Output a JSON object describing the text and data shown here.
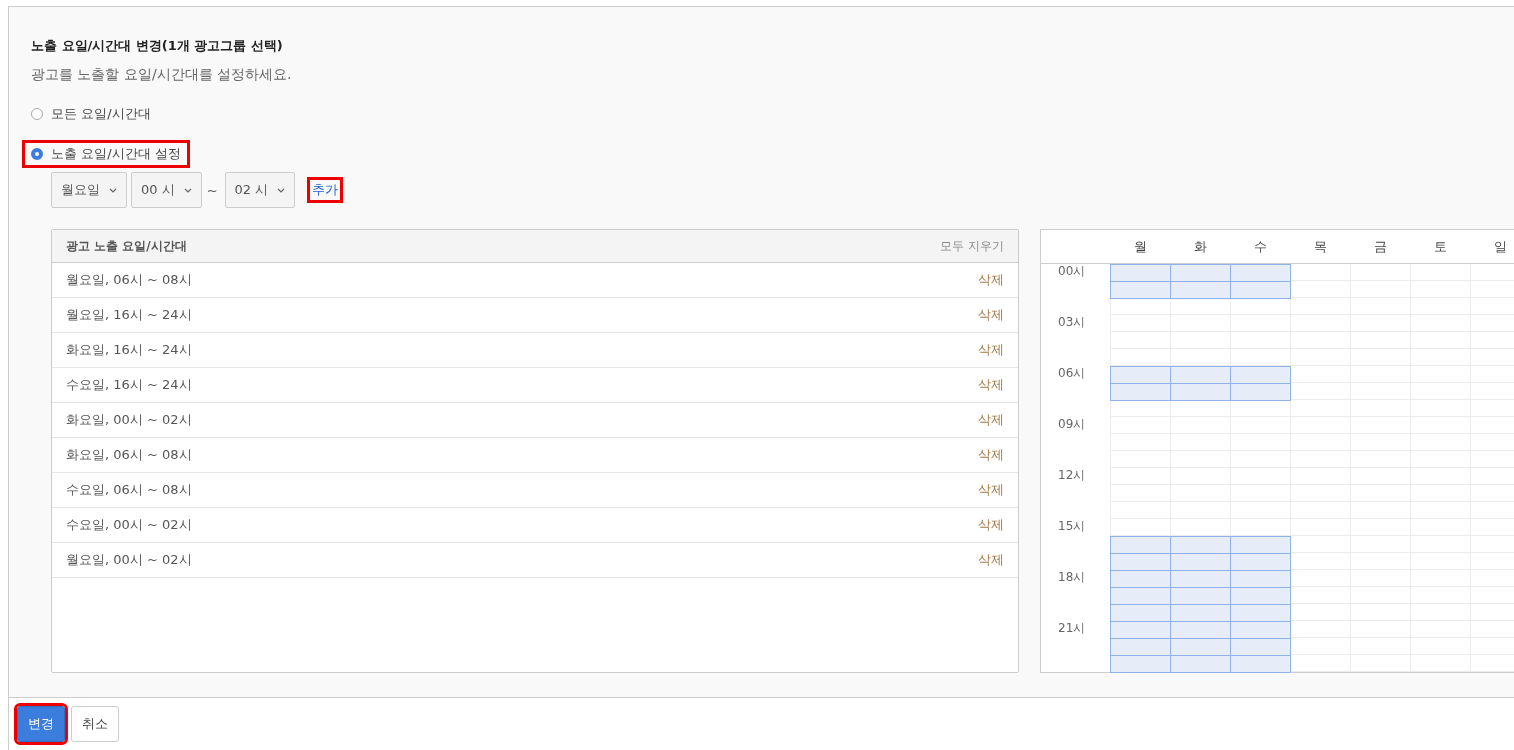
{
  "title": "노출 요일/시간대 변경(1개 광고그룹 선택)",
  "description": "광고를 노출할 요일/시간대를 설정하세요.",
  "radios": [
    {
      "label": "모든 요일/시간대",
      "selected": false,
      "highlighted": false
    },
    {
      "label": "노출 요일/시간대 설정",
      "selected": true,
      "highlighted": true
    }
  ],
  "picker": {
    "day": "월요일",
    "start": "00 시",
    "separator": "~",
    "end": "02 시",
    "add_link": {
      "label": "추가",
      "highlighted": true
    }
  },
  "schedule_list": {
    "header": "광고 노출 요일/시간대",
    "clear_all": "모두 지우기",
    "rows": [
      {
        "text": "월요일, 06시 ~ 08시",
        "action": "삭제"
      },
      {
        "text": "월요일, 16시 ~ 24시",
        "action": "삭제"
      },
      {
        "text": "화요일, 16시 ~ 24시",
        "action": "삭제"
      },
      {
        "text": "수요일, 16시 ~ 24시",
        "action": "삭제"
      },
      {
        "text": "화요일, 00시 ~ 02시",
        "action": "삭제"
      },
      {
        "text": "화요일, 06시 ~ 08시",
        "action": "삭제"
      },
      {
        "text": "수요일, 06시 ~ 08시",
        "action": "삭제"
      },
      {
        "text": "수요일, 00시 ~ 02시",
        "action": "삭제"
      },
      {
        "text": "월요일, 00시 ~ 02시",
        "action": "삭제"
      }
    ]
  },
  "week_grid": {
    "days": [
      "월",
      "화",
      "수",
      "목",
      "금",
      "토",
      "일"
    ],
    "rows": [
      {
        "label": "00시",
        "cells": [
          true,
          true,
          true,
          false,
          false,
          false,
          false
        ]
      },
      {
        "cells": [
          true,
          true,
          true,
          false,
          false,
          false,
          false
        ]
      },
      {
        "cells": [
          false,
          false,
          false,
          false,
          false,
          false,
          false
        ]
      },
      {
        "label": "03시",
        "cells": [
          false,
          false,
          false,
          false,
          false,
          false,
          false
        ]
      },
      {
        "cells": [
          false,
          false,
          false,
          false,
          false,
          false,
          false
        ]
      },
      {
        "cells": [
          false,
          false,
          false,
          false,
          false,
          false,
          false
        ]
      },
      {
        "label": "06시",
        "cells": [
          true,
          true,
          true,
          false,
          false,
          false,
          false
        ]
      },
      {
        "cells": [
          true,
          true,
          true,
          false,
          false,
          false,
          false
        ]
      },
      {
        "cells": [
          false,
          false,
          false,
          false,
          false,
          false,
          false
        ]
      },
      {
        "label": "09시",
        "cells": [
          false,
          false,
          false,
          false,
          false,
          false,
          false
        ]
      },
      {
        "cells": [
          false,
          false,
          false,
          false,
          false,
          false,
          false
        ]
      },
      {
        "cells": [
          false,
          false,
          false,
          false,
          false,
          false,
          false
        ]
      },
      {
        "label": "12시",
        "cells": [
          false,
          false,
          false,
          false,
          false,
          false,
          false
        ]
      },
      {
        "cells": [
          false,
          false,
          false,
          false,
          false,
          false,
          false
        ]
      },
      {
        "cells": [
          false,
          false,
          false,
          false,
          false,
          false,
          false
        ]
      },
      {
        "label": "15시",
        "cells": [
          false,
          false,
          false,
          false,
          false,
          false,
          false
        ]
      },
      {
        "cells": [
          true,
          true,
          true,
          false,
          false,
          false,
          false
        ]
      },
      {
        "cells": [
          true,
          true,
          true,
          false,
          false,
          false,
          false
        ]
      },
      {
        "label": "18시",
        "cells": [
          true,
          true,
          true,
          false,
          false,
          false,
          false
        ]
      },
      {
        "cells": [
          true,
          true,
          true,
          false,
          false,
          false,
          false
        ]
      },
      {
        "cells": [
          true,
          true,
          true,
          false,
          false,
          false,
          false
        ]
      },
      {
        "label": "21시",
        "cells": [
          true,
          true,
          true,
          false,
          false,
          false,
          false
        ]
      },
      {
        "cells": [
          true,
          true,
          true,
          false,
          false,
          false,
          false
        ]
      },
      {
        "cells": [
          true,
          true,
          true,
          false,
          false,
          false,
          false
        ]
      }
    ]
  },
  "buttons": [
    {
      "label": "변경",
      "kind": "primary",
      "highlighted": true
    },
    {
      "label": "취소",
      "kind": "default",
      "highlighted": false
    }
  ]
}
